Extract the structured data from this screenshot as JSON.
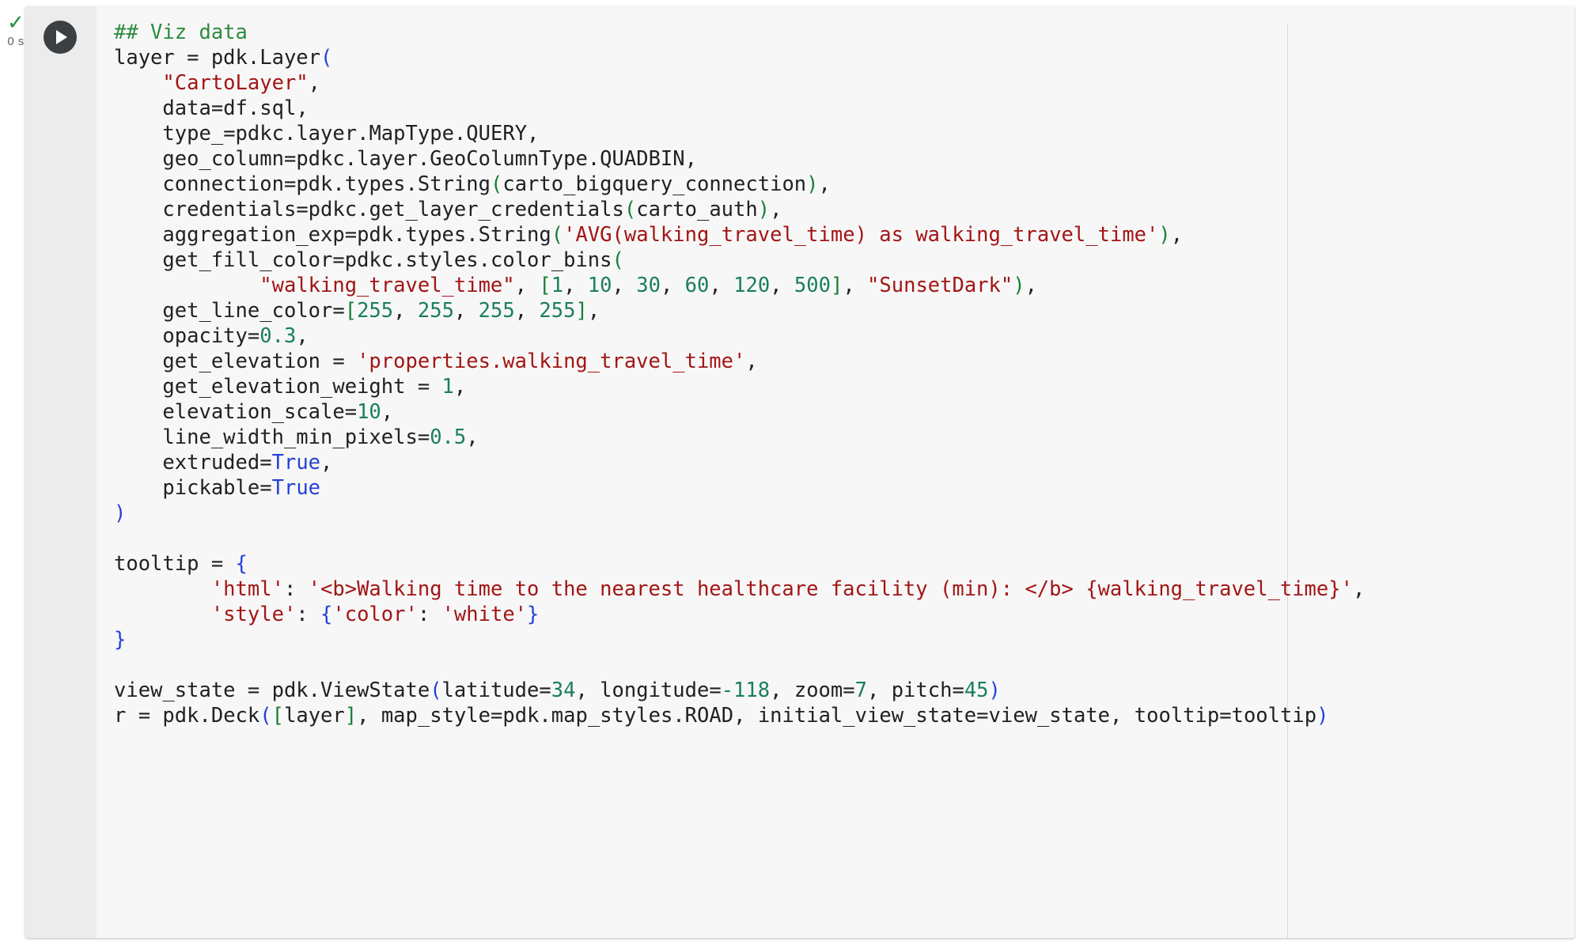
{
  "cell": {
    "execution_status_icon": "check-icon",
    "execution_status_glyph": "✓",
    "elapsed_time": "0 s",
    "run_button_icon": "play-icon",
    "language": "python",
    "colors": {
      "comment": "#2e8b3f",
      "string": "#a31515",
      "number": "#1a7f5a",
      "keyword": "#2540d8",
      "paren": "#1a7f37",
      "text": "#202124",
      "cell_background": "#f7f7f7",
      "gutter_background": "#ececec",
      "status_check": "#1e8e3e"
    },
    "code_lines": [
      "## Viz data",
      "layer = pdk.Layer(",
      "    \"CartoLayer\",",
      "    data=df.sql,",
      "    type_=pdkc.layer.MapType.QUERY,",
      "    geo_column=pdkc.layer.GeoColumnType.QUADBIN,",
      "    connection=pdk.types.String(carto_bigquery_connection),",
      "    credentials=pdkc.get_layer_credentials(carto_auth),",
      "    aggregation_exp=pdk.types.String('AVG(walking_travel_time) as walking_travel_time'),",
      "    get_fill_color=pdkc.styles.color_bins(",
      "            \"walking_travel_time\", [1, 10, 30, 60, 120, 500], \"SunsetDark\"),",
      "    get_line_color=[255, 255, 255, 255],",
      "    opacity=0.3,",
      "    get_elevation = 'properties.walking_travel_time',",
      "    get_elevation_weight = 1,",
      "    elevation_scale=10,",
      "    line_width_min_pixels=0.5,",
      "    extruded=True,",
      "    pickable=True",
      ")",
      "",
      "tooltip = {",
      "        'html': '<b>Walking time to the nearest healthcare facility (min): </b> {walking_travel_time}',",
      "        'style': {'color': 'white'}",
      "}",
      "",
      "view_state = pdk.ViewState(latitude=34, longitude=-118, zoom=7, pitch=45)",
      "r = pdk.Deck([layer], map_style=pdk.map_styles.ROAD, initial_view_state=view_state, tooltip=tooltip)"
    ]
  }
}
